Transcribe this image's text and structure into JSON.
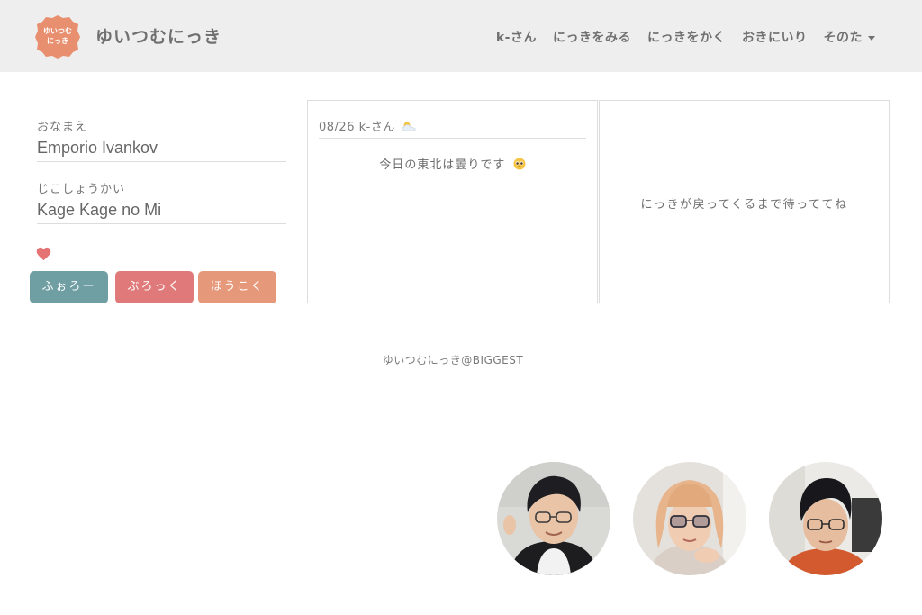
{
  "header": {
    "logo_text_line1": "ゆいつむ",
    "logo_text_line2": "にっき",
    "site_title": "ゆいつむにっき",
    "nav": [
      {
        "label": "k-さん"
      },
      {
        "label": "にっきをみる"
      },
      {
        "label": "にっきをかく"
      },
      {
        "label": "おきにいり"
      },
      {
        "label": "そのた"
      }
    ]
  },
  "profile": {
    "name_label": "おなまえ",
    "name_value": "Emporio Ivankov",
    "bio_label": "じこしょうかい",
    "bio_value": "Kage Kage no Mi",
    "buttons": {
      "follow": "ふぉろー",
      "block": "ぶろっく",
      "report": "ほうこく"
    }
  },
  "diaries": [
    {
      "date": "08/26",
      "author": "k-さん",
      "weather_icon": "sun-behind-cloud-icon",
      "body": "今日の東北は曇りです",
      "emoji": "pleading-face-icon"
    }
  ],
  "empty_message": "にっきが戻ってくるまで待っててね",
  "footer": {
    "text": "ゆいつむにっき@BIGGEST"
  },
  "colors": {
    "header_bg": "#eeeeee",
    "logo": "#e88f6f",
    "follow": "#6f9ea3",
    "block": "#e07a7a",
    "report": "#e6987a",
    "heart": "#e57373"
  }
}
